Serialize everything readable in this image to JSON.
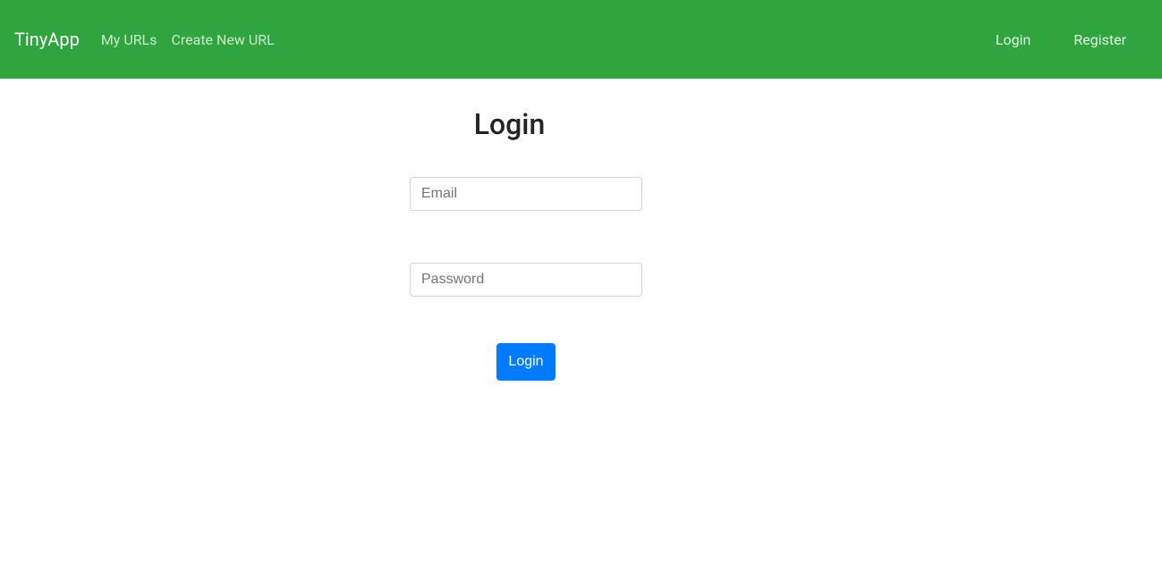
{
  "navbar": {
    "brand": "TinyApp",
    "links": {
      "my_urls": "My URLs",
      "create_new_url": "Create New URL",
      "login": "Login",
      "register": "Register"
    }
  },
  "page": {
    "title": "Login"
  },
  "form": {
    "email": {
      "placeholder": "Email",
      "value": ""
    },
    "password": {
      "placeholder": "Password",
      "value": ""
    },
    "submit_label": "Login"
  }
}
